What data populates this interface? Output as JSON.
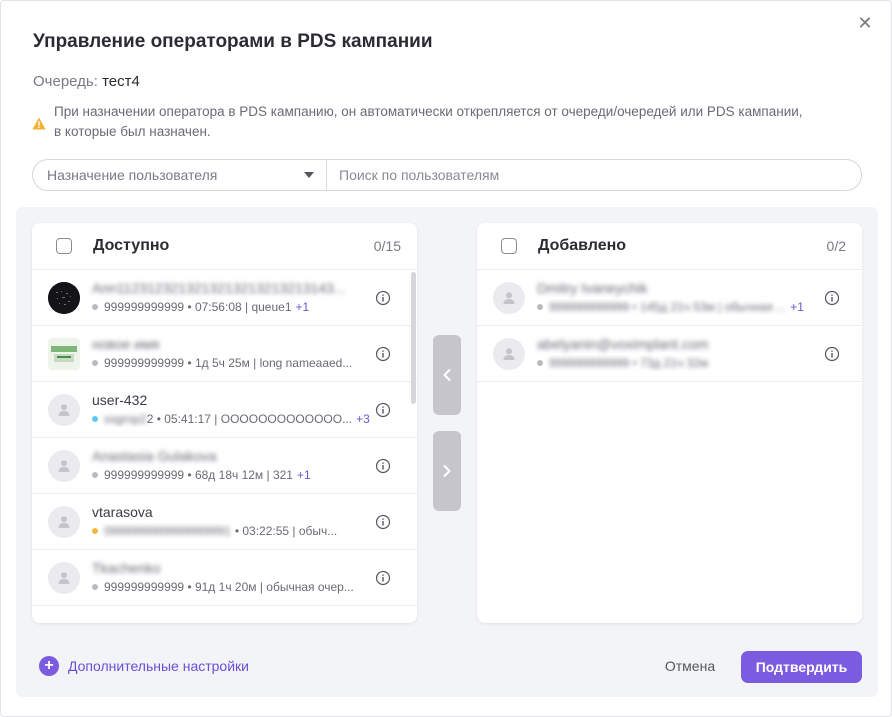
{
  "dialog": {
    "title": "Управление операторами в PDS кампании",
    "close_icon": "close-icon",
    "queue_label": "Очередь:",
    "queue_value": "тест4",
    "warning": "При назначении оператора в PDS кампанию, он автоматически открепляется от очереди/очередей или PDS кампании, в которые был назначен."
  },
  "filters": {
    "assignment_select": "Назначение пользователя",
    "search_placeholder": "Поиск по пользователям"
  },
  "colors": {
    "accent": "#7b5be0",
    "status_blue": "#5ec8ec",
    "status_yellow": "#f0b73a",
    "status_gray": "#b9b9c2"
  },
  "available": {
    "title": "Доступно",
    "count": "0/15",
    "items": [
      {
        "name": "Ann1123123213213213213213213143...",
        "meta": "999999999999 • 07:56:08 | queue1",
        "extra": "+1"
      },
      {
        "name": "новое имя",
        "meta": "999999999999 • 1д 5ч 25м | long nameaaed...",
        "extra": ""
      },
      {
        "name": "user-432",
        "meta_blurred": "ssgrop2",
        "meta": "2 • 05:41:17 | OOOOOOOOOOOOO...",
        "extra": "+3"
      },
      {
        "name": "Anastasia Gulakova",
        "meta": "999999999999 • 68д 18ч 12м | 321",
        "extra": "+1"
      },
      {
        "name": "vtarasova",
        "meta_blurred": "0999999999999999991",
        "meta": "• 03:22:55 | обыч...",
        "extra": ""
      },
      {
        "name": "Tkachenko",
        "meta": "999999999999 • 91д 1ч 20м | обычная очер...",
        "extra": ""
      }
    ]
  },
  "added": {
    "title": "Добавлено",
    "count": "0/2",
    "items": [
      {
        "name": "Dmitry Ivaneychik",
        "meta": "999999999999 • 145д 21ч 53м | обычная ...",
        "extra": "+1"
      },
      {
        "name": "abelyanin@voximplant.com",
        "meta": "999999999999 • 73д 21ч 32м",
        "extra": ""
      }
    ]
  },
  "footer": {
    "extra_settings": "Дополнительные настройки",
    "cancel": "Отмена",
    "confirm": "Подтвердить"
  }
}
